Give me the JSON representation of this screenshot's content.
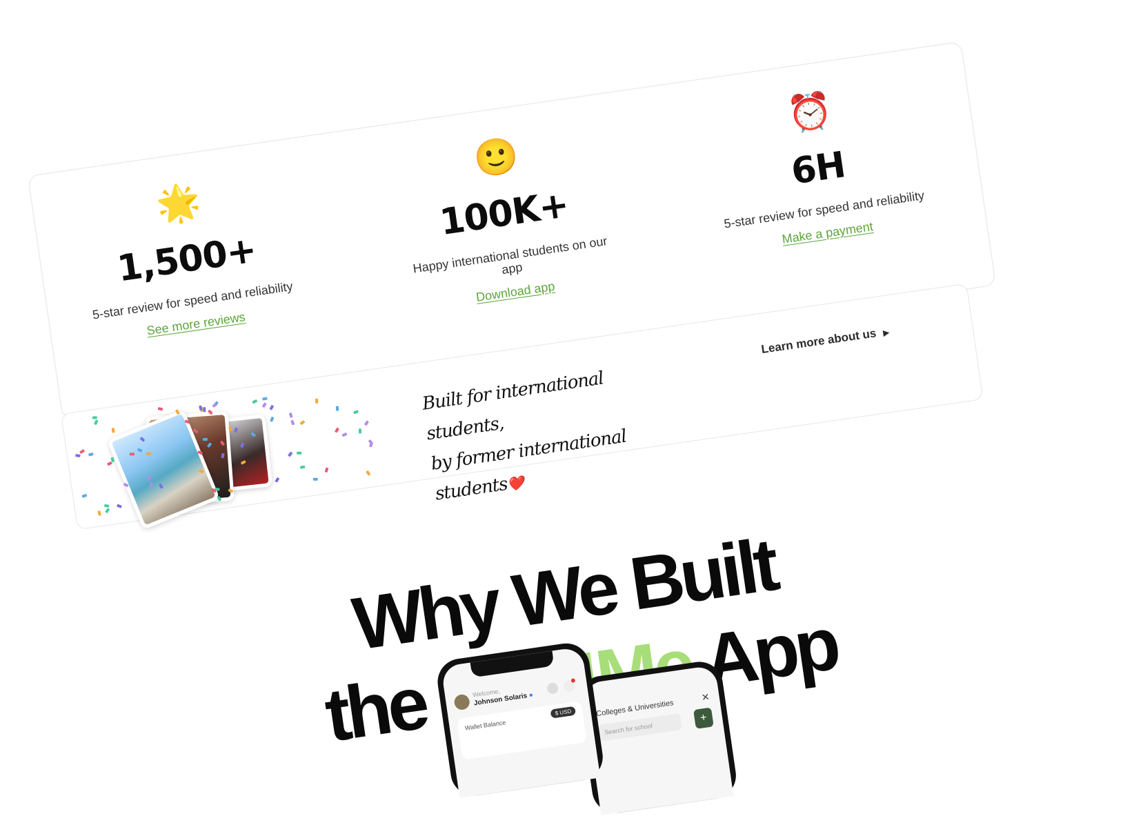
{
  "stats": [
    {
      "emoji": "🌟",
      "value": "1,500+",
      "desc": "5-star review for speed and reliability",
      "link": "See more reviews"
    },
    {
      "emoji": "🙂",
      "value": "100K+",
      "desc": "Happy international students on our app",
      "link": "Download app"
    },
    {
      "emoji": "⏰",
      "value": "6H",
      "desc": "5-star review for speed and reliability",
      "link": "Make a payment"
    }
  ],
  "banner": {
    "tagline_line1": "Built for international students,",
    "tagline_line2": "by former international students",
    "heart": "❤️",
    "learn_more": "Learn more about us",
    "arrow": "▶"
  },
  "headline": {
    "line1": "Why We Built",
    "line2_prefix": "the ",
    "line2_accent": "Pay4Me",
    "line2_suffix": " App"
  },
  "phone_front": {
    "welcome": "Welcome,",
    "user_name": "Johnson Solaris",
    "wallet_label": "Wallet Balance",
    "currency": "$ USD"
  },
  "phone_back": {
    "title": "Colleges & Universities",
    "search_placeholder": "Search for school",
    "add_label": "+"
  },
  "colors": {
    "accent_green": "#5aa53a",
    "headline_accent": "#a7de79",
    "text": "#111111",
    "border": "#e6e6e6"
  }
}
